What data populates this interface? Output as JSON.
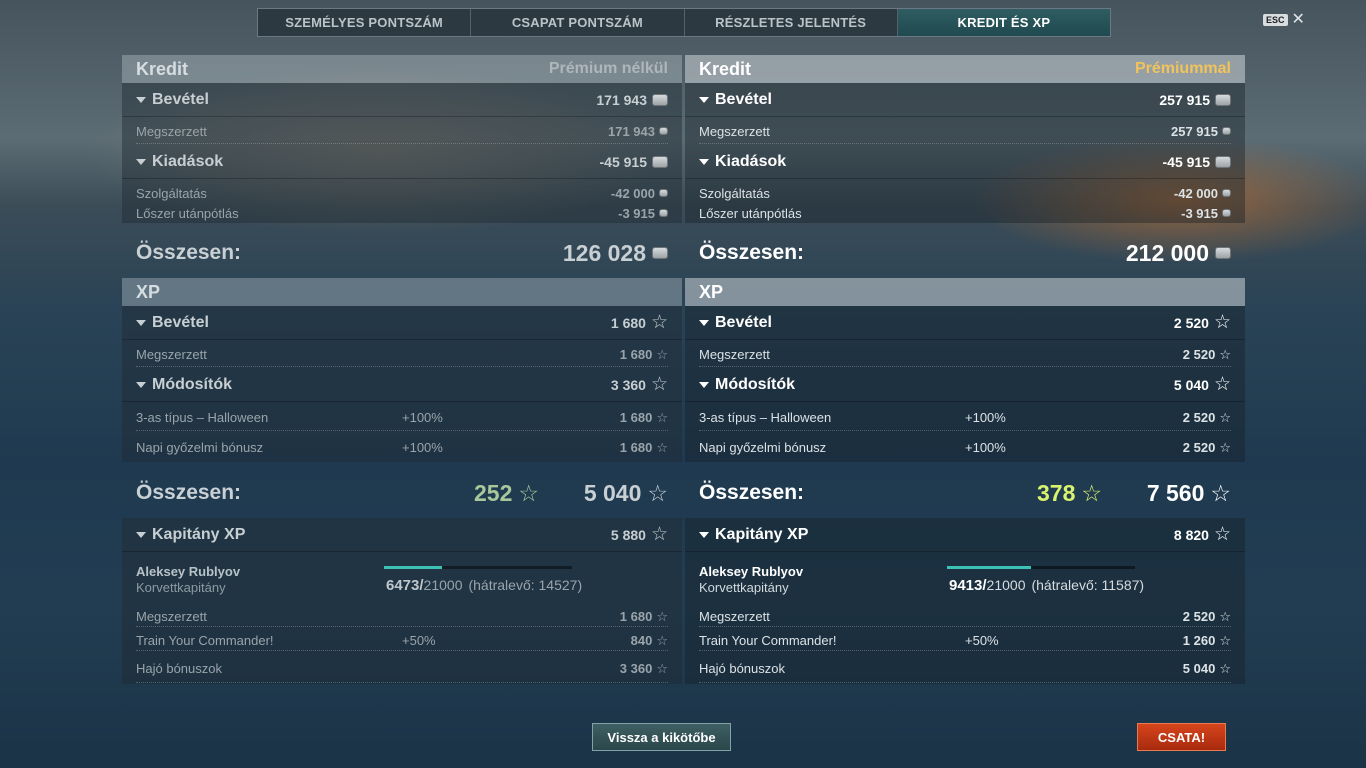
{
  "tabs": [
    "SZEMÉLYES PONTSZÁM",
    "CSAPAT PONTSZÁM",
    "RÉSZLETES JELENTÉS",
    "KREDIT ÉS XP"
  ],
  "esc_label": "ESC",
  "left": {
    "credit_title": "Kredit",
    "premium_label": "Prémium nélkül",
    "income_label": "Bevétel",
    "income_total": "171 943",
    "earned_label": "Megszerzett",
    "earned_value": "171 943",
    "expenses_label": "Kiadások",
    "expenses_total": "-45 915",
    "service_label": "Szolgáltatás",
    "service_value": "-42 000",
    "ammo_label": "Lőszer utánpótlás",
    "ammo_value": "-3 915",
    "credit_total_label": "Összesen:",
    "credit_total": "126 028",
    "xp_title": "XP",
    "xp_income_label": "Bevétel",
    "xp_income_total": "1 680",
    "xp_earned_label": "Megszerzett",
    "xp_earned_value": "1 680",
    "modifiers_label": "Módosítók",
    "modifiers_total": "3 360",
    "mod1_label": "3-as típus – Halloween",
    "mod1_pct": "+100%",
    "mod1_value": "1 680",
    "mod2_label": "Napi győzelmi bónusz",
    "mod2_pct": "+100%",
    "mod2_value": "1 680",
    "xp_total_label": "Összesen:",
    "xp_free": "252",
    "xp_total": "5 040",
    "captain_label": "Kapitány XP",
    "captain_total": "5 880",
    "captain_name": "Aleksey Rublyov",
    "captain_rank": "Korvettkapitány",
    "captain_xp": "6473/",
    "captain_xp_max": "21000",
    "captain_remaining": "(hátralevő: 14527)",
    "captain_progress": 0.308,
    "cap_earned_label": "Megszerzett",
    "cap_earned_value": "1 680",
    "cap_train_label": "Train Your Commander!",
    "cap_train_pct": "+50%",
    "cap_train_value": "840",
    "cap_ship_label": "Hajó bónuszok",
    "cap_ship_value": "3 360"
  },
  "right": {
    "credit_title": "Kredit",
    "premium_label": "Prémiummal",
    "income_label": "Bevétel",
    "income_total": "257 915",
    "earned_label": "Megszerzett",
    "earned_value": "257 915",
    "expenses_label": "Kiadások",
    "expenses_total": "-45 915",
    "service_label": "Szolgáltatás",
    "service_value": "-42 000",
    "ammo_label": "Lőszer utánpótlás",
    "ammo_value": "-3 915",
    "credit_total_label": "Összesen:",
    "credit_total": "212 000",
    "xp_title": "XP",
    "xp_income_label": "Bevétel",
    "xp_income_total": "2 520",
    "xp_earned_label": "Megszerzett",
    "xp_earned_value": "2 520",
    "modifiers_label": "Módosítók",
    "modifiers_total": "5 040",
    "mod1_label": "3-as típus – Halloween",
    "mod1_pct": "+100%",
    "mod1_value": "2 520",
    "mod2_label": "Napi győzelmi bónusz",
    "mod2_pct": "+100%",
    "mod2_value": "2 520",
    "xp_total_label": "Összesen:",
    "xp_free": "378",
    "xp_total": "7 560",
    "captain_label": "Kapitány XP",
    "captain_total": "8 820",
    "captain_name": "Aleksey Rublyov",
    "captain_rank": "Korvettkapitány",
    "captain_xp": "9413/",
    "captain_xp_max": "21000",
    "captain_remaining": "(hátralevő: 11587)",
    "captain_progress": 0.448,
    "cap_earned_label": "Megszerzett",
    "cap_earned_value": "2 520",
    "cap_train_label": "Train Your Commander!",
    "cap_train_pct": "+50%",
    "cap_train_value": "1 260",
    "cap_ship_label": "Hajó bónuszok",
    "cap_ship_value": "5 040"
  },
  "buttons": {
    "port": "Vissza a kikötőbe",
    "battle": "CSATA!"
  },
  "icons": {
    "credit": "credit-coin-icon",
    "xp": "star-icon"
  }
}
